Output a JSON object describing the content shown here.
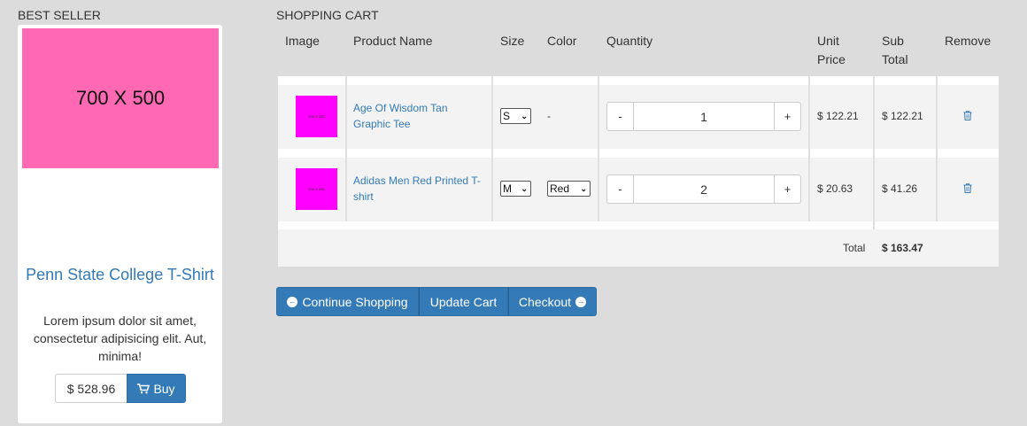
{
  "best_seller": {
    "heading": "BEST SELLER",
    "image_text": "700 X 500",
    "image_color": "#ff69b4",
    "product_name": "Penn State College T-Shirt",
    "description": "Lorem ipsum dolor sit amet, consectetur adipisicing elit. Aut, minima!",
    "price": "$ 528.96",
    "buy_label": "Buy",
    "cart_icon": "shopping-cart-icon"
  },
  "cart": {
    "heading": "SHOPPING CART",
    "columns": {
      "image": "Image",
      "product_name": "Product Name",
      "size": "Size",
      "color": "Color",
      "quantity": "Quantity",
      "unit_price_1": "Unit",
      "unit_price_2": "Price",
      "sub_total_1": "Sub",
      "sub_total_2": "Total",
      "remove": "Remove"
    },
    "items": [
      {
        "thumb_text": "200 X 200",
        "name": "Age Of Wisdom Tan Graphic Tee",
        "size": "S",
        "color": "-",
        "qty_minus": "-",
        "quantity": "1",
        "qty_plus": "+",
        "unit_price": "$ 122.21",
        "sub_total": "$ 122.21"
      },
      {
        "thumb_text": "200 X 200",
        "name": "Adidas Men Red Printed T-shirt",
        "size": "M",
        "color": "Red",
        "qty_minus": "-",
        "quantity": "2",
        "qty_plus": "+",
        "unit_price": "$ 20.63",
        "sub_total": "$ 41.26"
      }
    ],
    "total_label": "Total",
    "total_value": "$ 163.47",
    "thumb_color": "#ff00ff"
  },
  "actions": {
    "continue": "Continue Shopping",
    "update": "Update Cart",
    "checkout": "Checkout",
    "continue_icon": "arrow-circle-left-icon",
    "checkout_icon": "arrow-circle-right-icon"
  },
  "colors": {
    "accent": "#337ab7",
    "background": "#dcdcdc"
  }
}
